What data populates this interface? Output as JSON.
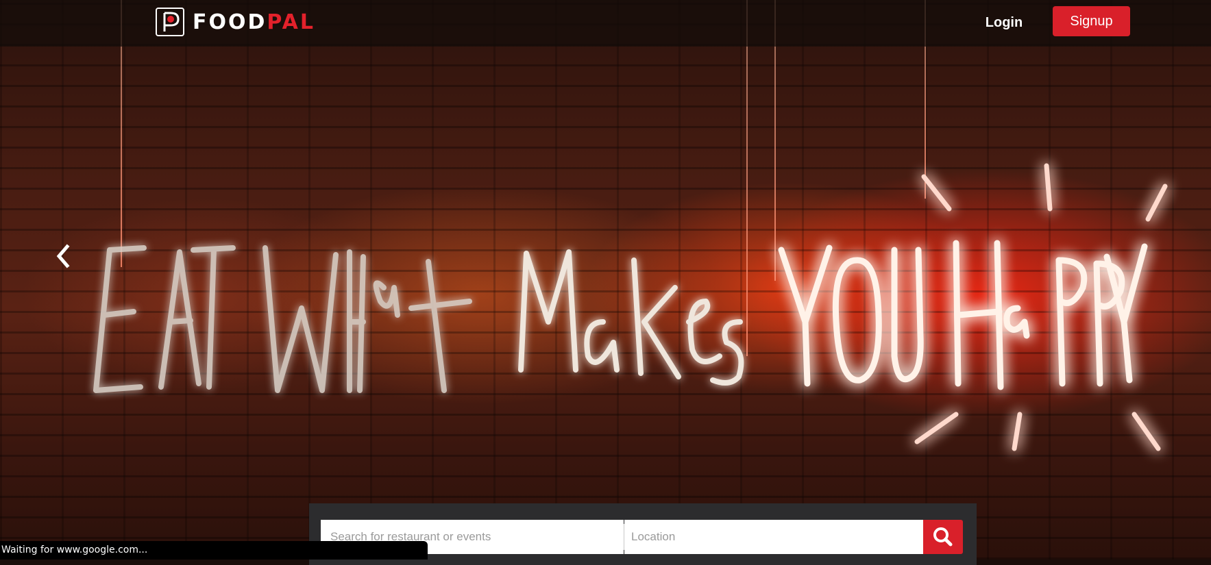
{
  "brand": {
    "name_part1": "FOOD",
    "name_part2": "PAL",
    "accent_color": "#e3212b"
  },
  "nav": {
    "login_label": "Login",
    "signup_label": "Signup"
  },
  "hero": {
    "neon_sign": "EAT WHat MaKes YOU HaPPY",
    "prev_icon": "chevron-left-icon"
  },
  "search": {
    "query_placeholder": "Search for restaurant or events",
    "location_placeholder": "Location",
    "button_icon": "search-icon",
    "button_color": "#d9202a"
  },
  "status_bar": {
    "text": "Waiting for www.google.com..."
  }
}
